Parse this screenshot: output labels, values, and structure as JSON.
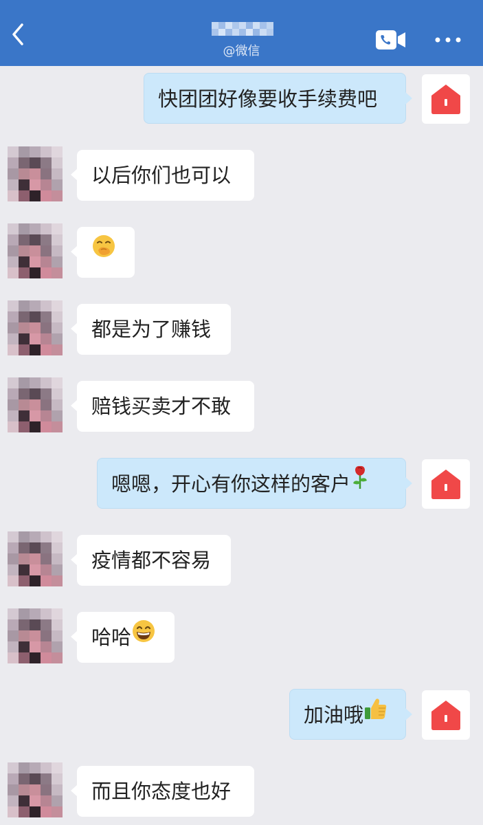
{
  "header": {
    "source_label": "@微信",
    "back_icon": "chevron-left-icon",
    "video_icon": "video-call-icon",
    "more_icon": "more-dots-icon",
    "background_color": "#3a76c8"
  },
  "messages": [
    {
      "direction": "out",
      "text": "快团团好像要收手续费吧"
    },
    {
      "direction": "in",
      "text": "以后你们也可以"
    },
    {
      "direction": "in",
      "text": "",
      "emoji": "face-with-hand-over-mouth-emoji"
    },
    {
      "direction": "in",
      "text": "都是为了赚钱"
    },
    {
      "direction": "in",
      "text": "赔钱买卖才不敢"
    },
    {
      "direction": "out",
      "text": "嗯嗯，开心有你这样的客户",
      "emoji": "rose-emoji"
    },
    {
      "direction": "in",
      "text": "疫情都不容易"
    },
    {
      "direction": "in",
      "text": "哈哈",
      "emoji": "grinning-face-emoji"
    },
    {
      "direction": "out",
      "text": "加油哦",
      "emoji": "thumbs-up-emoji"
    },
    {
      "direction": "in",
      "text": "而且你态度也好"
    }
  ],
  "colors": {
    "chat_background": "#ebebef",
    "incoming_bubble": "#ffffff",
    "outgoing_bubble": "#cce8fb",
    "my_avatar_icon": "#f04848"
  }
}
